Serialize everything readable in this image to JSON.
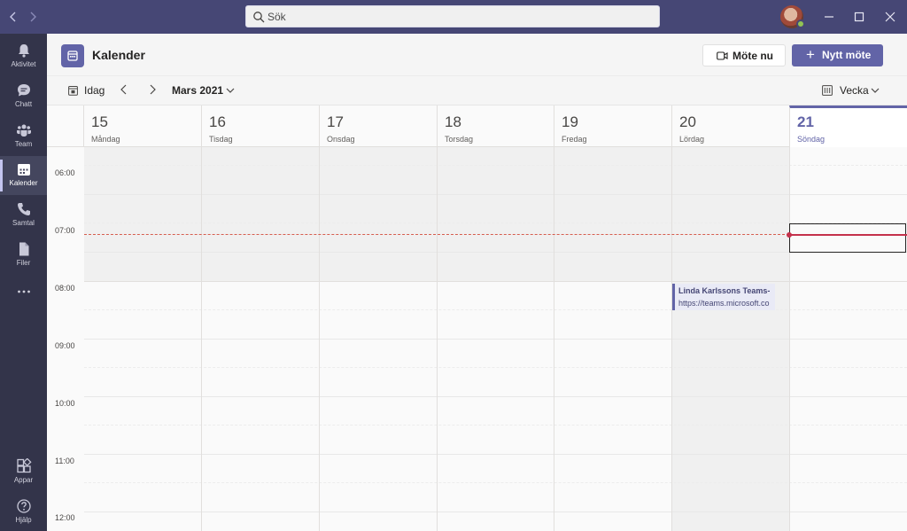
{
  "search": {
    "placeholder": "Sök"
  },
  "rail": [
    {
      "label": "Aktivitet",
      "icon": "bell-icon"
    },
    {
      "label": "Chatt",
      "icon": "chat-icon"
    },
    {
      "label": "Team",
      "icon": "team-icon"
    },
    {
      "label": "Kalender",
      "icon": "calendar-icon",
      "active": true
    },
    {
      "label": "Samtal",
      "icon": "phone-icon"
    },
    {
      "label": "Filer",
      "icon": "file-icon"
    },
    {
      "label": "Appar",
      "icon": "apps-icon"
    },
    {
      "label": "Hjälp",
      "icon": "help-icon"
    }
  ],
  "header": {
    "title": "Kalender",
    "meet_now_label": "Möte nu",
    "new_meeting_label": "Nytt möte"
  },
  "toolbar": {
    "today_label": "Idag",
    "month_label": "Mars 2021",
    "view_label": "Vecka"
  },
  "days": [
    {
      "num": "15",
      "name": "Måndag"
    },
    {
      "num": "16",
      "name": "Tisdag"
    },
    {
      "num": "17",
      "name": "Onsdag"
    },
    {
      "num": "18",
      "name": "Torsdag"
    },
    {
      "num": "19",
      "name": "Fredag"
    },
    {
      "num": "20",
      "name": "Lördag"
    },
    {
      "num": "21",
      "name": "Söndag",
      "today": true
    }
  ],
  "times": [
    "06:00",
    "07:00",
    "08:00",
    "09:00",
    "10:00",
    "11:00",
    "12:00"
  ],
  "event": {
    "title": "Linda Karlssons Teams-",
    "url": "https://teams.microsoft.co"
  },
  "colors": {
    "accent": "#6264a7",
    "titlebar": "#464775",
    "rail": "#33344a",
    "now_line": "#c4314b"
  }
}
